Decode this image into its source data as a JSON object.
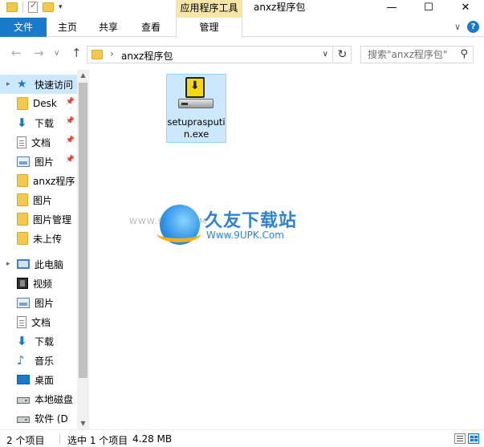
{
  "titlebar": {
    "context_tab_group": "应用程序工具",
    "window_title": "anxz程序包",
    "minimize": "—",
    "maximize": "☐",
    "close": "✕"
  },
  "ribbon": {
    "tabs": [
      {
        "label": "文件"
      },
      {
        "label": "主页"
      },
      {
        "label": "共享"
      },
      {
        "label": "查看"
      },
      {
        "label": "管理"
      }
    ]
  },
  "address": {
    "breadcrumb": "anxz程序包",
    "search_placeholder": "搜索\"anxz程序包\""
  },
  "nav_pane": {
    "quick_access": "快速访问",
    "items": [
      {
        "label": "Desk",
        "icon": "folder-icon",
        "pinned": true
      },
      {
        "label": "下载",
        "icon": "download-icon",
        "pinned": true
      },
      {
        "label": "文档",
        "icon": "document-icon",
        "pinned": true
      },
      {
        "label": "图片",
        "icon": "picture-icon",
        "pinned": true
      },
      {
        "label": "anxz程序",
        "icon": "folder-icon",
        "pinned": false
      },
      {
        "label": "图片",
        "icon": "folder-icon",
        "pinned": false
      },
      {
        "label": "图片管理",
        "icon": "folder-icon",
        "pinned": false
      },
      {
        "label": "未上传",
        "icon": "folder-icon",
        "pinned": false
      }
    ],
    "this_pc": "此电脑",
    "pc_items": [
      {
        "label": "视频",
        "icon": "video-icon"
      },
      {
        "label": "图片",
        "icon": "picture-icon"
      },
      {
        "label": "文档",
        "icon": "document-icon"
      },
      {
        "label": "下载",
        "icon": "download-icon"
      },
      {
        "label": "音乐",
        "icon": "music-icon"
      },
      {
        "label": "桌面",
        "icon": "desktop-icon"
      },
      {
        "label": "本地磁盘",
        "icon": "drive-icon"
      },
      {
        "label": "软件 (D",
        "icon": "drive-icon"
      }
    ]
  },
  "content": {
    "files": [
      {
        "name": "setuprasputin.exe",
        "icon": "installer-icon",
        "selected": true
      }
    ],
    "watermark": {
      "title": "久友下载站",
      "url": "Www.9UPK.Com",
      "left_text": "WWW.9UPK.COM"
    }
  },
  "status": {
    "item_count": "2 个项目",
    "selected": "选中 1 个项目",
    "size": "4.28 MB"
  },
  "colors": {
    "accent": "#1979ca",
    "selection": "#cce8ff",
    "context_tab": "#f5e6a8"
  }
}
